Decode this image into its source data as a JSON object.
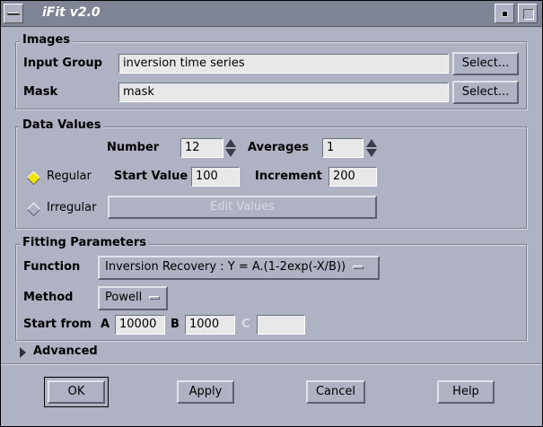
{
  "window": {
    "title": "iFit v2.0"
  },
  "images": {
    "section_title": "Images",
    "input_group_label": "Input Group",
    "input_group_value": "inversion time series",
    "mask_label": "Mask",
    "mask_value": "mask",
    "select_label": "Select..."
  },
  "data_values": {
    "section_title": "Data Values",
    "number_label": "Number",
    "number_value": "12",
    "averages_label": "Averages",
    "averages_value": "1",
    "regular_label": "Regular",
    "irregular_label": "Irregular",
    "start_value_label": "Start Value",
    "start_value": "100",
    "increment_label": "Increment",
    "increment_value": "200",
    "edit_values_label": "Edit Values",
    "selected_mode": "Regular"
  },
  "fitting": {
    "section_title": "Fitting Parameters",
    "function_label": "Function",
    "function_value": "Inversion Recovery : Y = A.(1-2exp(-X/B))",
    "method_label": "Method",
    "method_value": "Powell",
    "start_from_label": "Start from",
    "a_label": "A",
    "a_value": "10000",
    "b_label": "B",
    "b_value": "1000",
    "c_label": "C",
    "c_value": ""
  },
  "advanced": {
    "label": "Advanced"
  },
  "buttons": {
    "ok": "OK",
    "apply": "Apply",
    "cancel": "Cancel",
    "help": "Help"
  }
}
